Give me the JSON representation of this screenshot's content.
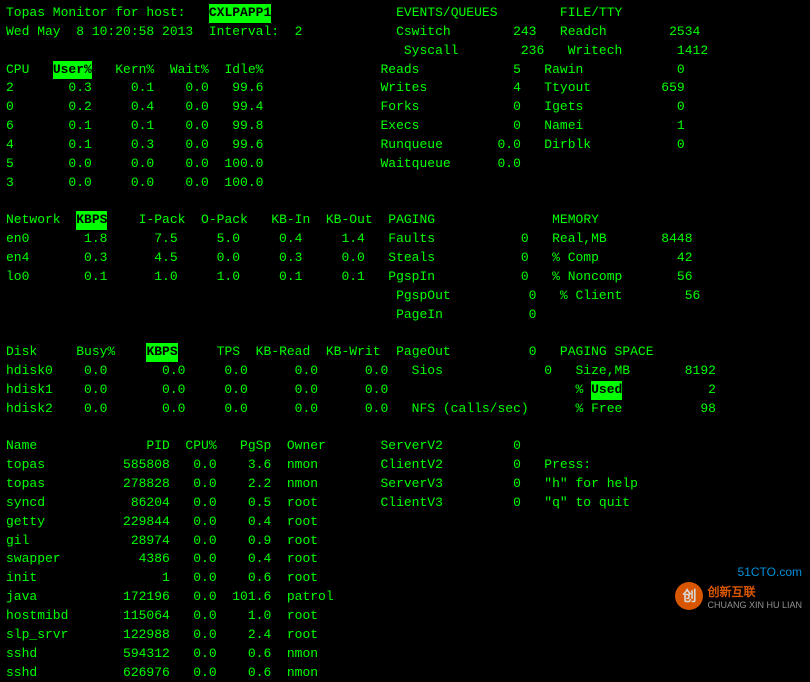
{
  "title": "Topas Monitor",
  "header": {
    "line1": "Topas Monitor for host:   CXLPAPP1                EVENTS/QUEUES        FILE/TTY",
    "line2": "Wed May  8 10:20:58 2013  Interval:  2            Cswitch        243   Readch        2534",
    "line3": "                                                   Syscall        236   Writech       1412",
    "cpu_header": "CPU   User%   Kern%  Wait%  Idle%               Reads            5   Rawin            0",
    "cpu_rows": [
      "2       0.3     0.1    0.0   99.6               Writes           4   Ttyout         659",
      "0       0.2     0.4    0.0   99.4               Forks            0   Igets            0",
      "6       0.1     0.1    0.0   99.8               Execs            0   Namei            1",
      "4       0.1     0.3    0.0   99.6               Runqueue       0.0   Dirblk           0",
      "5       0.0     0.0    0.0  100.0               Waitqueue      0.0",
      "3       0.0     0.0    0.0  100.0"
    ],
    "net_header": "Network  KBPS    I-Pack  O-Pack   KB-In  KB-Out  PAGING               MEMORY",
    "net_rows": [
      "en0       1.8      7.5     5.0     0.4     1.4   Faults           0   Real,MB       8448",
      "en4       0.3      4.5     0.0     0.3     0.0   Steals           0   % Comp          42",
      "lo0       0.1      1.0     1.0     0.1     0.1   PgspIn           0   % Noncomp       56",
      "                                                  PgspOut          0   % Client        56",
      "                                                  PageIn           0"
    ],
    "disk_header": "Disk     Busy%    KBPS     TPS  KB-Read  KB-Writ  PageOut          0   PAGING SPACE",
    "disk_rows": [
      "hdisk0    0.0       0.0     0.0      0.0      0.0   Sios             0   Size,MB       8192",
      "hdisk1    0.0       0.0     0.0      0.0      0.0                        % Used           2",
      "hdisk2    0.0       0.0     0.0      0.0      0.0   NFS (calls/sec)      % Free          98"
    ],
    "proc_header": "Name              PID  CPU%   PgSp  Owner       ServerV2         0",
    "proc_rows": [
      "topas          585808   0.0    3.6  nmon        ClientV2         0   Press:",
      "topas          278828   0.0    2.2  nmon        ServerV3         0   \"h\" for help",
      "syncd           86204   0.0    0.5  root        ClientV3         0   \"q\" to quit",
      "getty          229844   0.0    0.4  root",
      "gil             28974   0.0    0.9  root",
      "swapper          4386   0.0    0.4  root",
      "init                1   0.0    0.6  root",
      "java           172196   0.0  101.6  patrol",
      "hostmibd       115064   0.0    1.0  root",
      "slp_srvr       122988   0.0    2.4  root",
      "sshd           594312   0.0    0.6  nmon",
      "sshd           626976   0.0    0.6  nmon"
    ]
  },
  "watermark": {
    "site": "51CTO.com",
    "company": "创新互联",
    "subtitle": "CHUANG XIN HU LIAN"
  }
}
